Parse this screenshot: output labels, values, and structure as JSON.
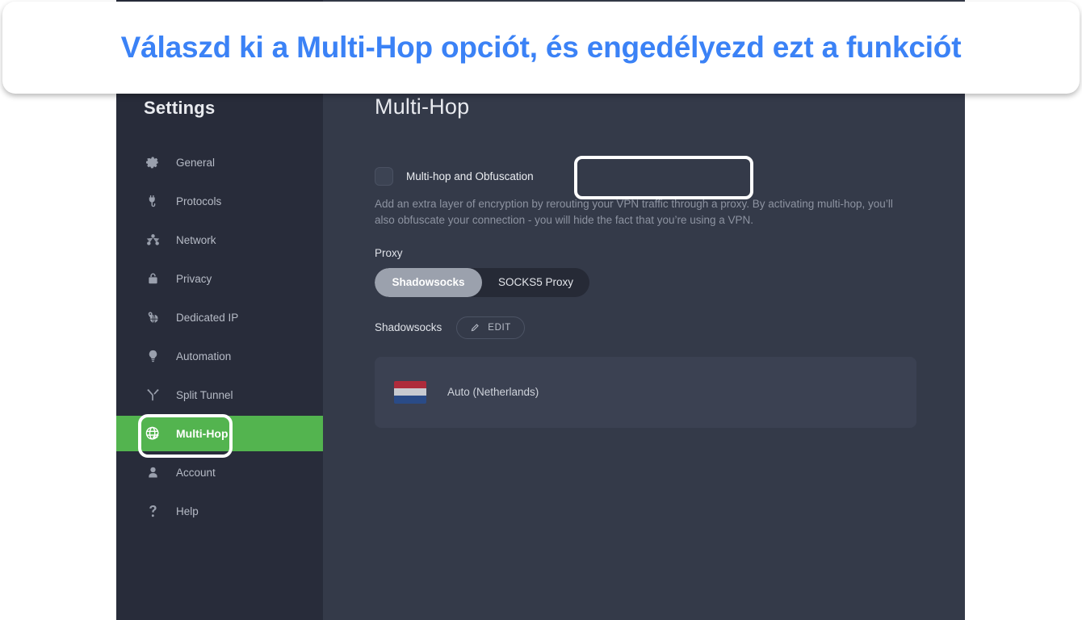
{
  "banner": {
    "text": "Válaszd ki a Multi-Hop opciót, és engedélyezd ezt a funkciót",
    "text_color": "#3b82f6"
  },
  "sidebar": {
    "title": "Settings",
    "active_item": "Multi-Hop",
    "highlight_color": "#53b44f",
    "items": [
      {
        "label": "General",
        "icon": "gear-icon"
      },
      {
        "label": "Protocols",
        "icon": "plug-icon"
      },
      {
        "label": "Network",
        "icon": "network-nodes-icon"
      },
      {
        "label": "Privacy",
        "icon": "lock-icon"
      },
      {
        "label": "Dedicated IP",
        "icon": "dedicated-ip-icon"
      },
      {
        "label": "Automation",
        "icon": "lightbulb-icon"
      },
      {
        "label": "Split Tunnel",
        "icon": "split-tunnel-icon"
      },
      {
        "label": "Multi-Hop",
        "icon": "globe-arrow-icon"
      },
      {
        "label": "Account",
        "icon": "person-icon"
      },
      {
        "label": "Help",
        "icon": "question-mark-icon"
      }
    ]
  },
  "main": {
    "title": "Multi-Hop",
    "toggle": {
      "label": "Multi-hop and Obfuscation",
      "checked": false
    },
    "description": "Add an extra layer of encryption by rerouting your VPN traffic through a proxy. By activating multi-hop, you’ll also obfuscate your connection - you will hide the fact that you’re using a VPN.",
    "proxy": {
      "label": "Proxy",
      "options": [
        "Shadowsocks",
        "SOCKS5 Proxy"
      ],
      "selected": "Shadowsocks"
    },
    "shadowsocks": {
      "name": "Shadowsocks",
      "edit_label": "EDIT"
    },
    "server": {
      "name": "Auto (Netherlands)",
      "flag": {
        "name": "netherlands-flag",
        "bands": [
          "#ae2b3b",
          "#c8cad0",
          "#2a4b87"
        ]
      }
    }
  }
}
